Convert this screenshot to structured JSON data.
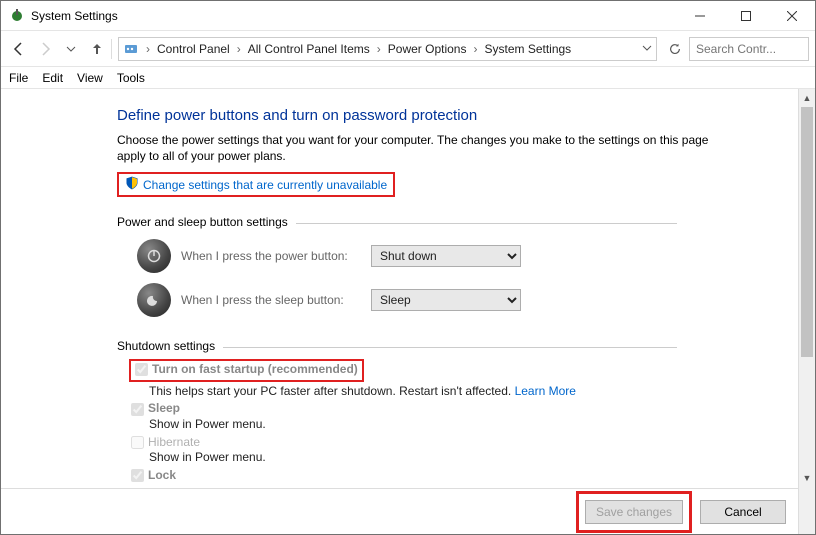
{
  "window": {
    "title": "System Settings"
  },
  "breadcrumb": {
    "items": [
      "Control Panel",
      "All Control Panel Items",
      "Power Options",
      "System Settings"
    ]
  },
  "search": {
    "placeholder": "Search Contr..."
  },
  "menu": {
    "file": "File",
    "edit": "Edit",
    "view": "View",
    "tools": "Tools"
  },
  "page": {
    "title": "Define power buttons and turn on password protection",
    "description": "Choose the power settings that you want for your computer. The changes you make to the settings on this page apply to all of your power plans.",
    "change_link": "Change settings that are currently unavailable"
  },
  "sections": {
    "buttons_label": "Power and sleep button settings",
    "power_btn_label": "When I press the power button:",
    "power_btn_value": "Shut down",
    "sleep_btn_label": "When I press the sleep button:",
    "sleep_btn_value": "Sleep",
    "shutdown_label": "Shutdown settings"
  },
  "shutdown": {
    "fast": {
      "label": "Turn on fast startup (recommended)",
      "sub": "This helps start your PC faster after shutdown. Restart isn't affected. ",
      "learn": "Learn More",
      "checked": true
    },
    "sleep": {
      "label": "Sleep",
      "sub": "Show in Power menu.",
      "checked": true
    },
    "hibernate": {
      "label": "Hibernate",
      "sub": "Show in Power menu.",
      "checked": false
    },
    "lock": {
      "label": "Lock",
      "checked": true
    }
  },
  "footer": {
    "save": "Save changes",
    "cancel": "Cancel"
  }
}
